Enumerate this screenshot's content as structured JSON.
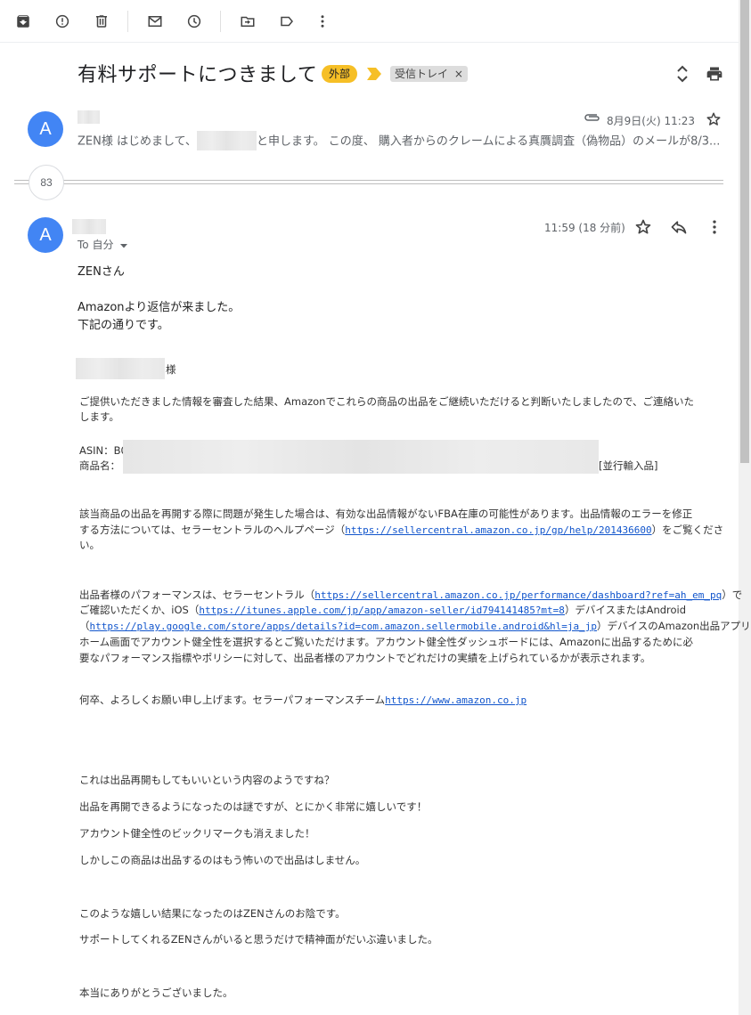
{
  "subject": "有料サポートにつきまして",
  "labels": {
    "external": "外部",
    "inbox": "受信トレイ",
    "inbox_remove": "×"
  },
  "collapsed_count": "83",
  "first_message": {
    "avatar_initial": "A",
    "date": "8月9日(火) 11:23",
    "snippet_a": "ZEN様 はじめまして、",
    "snippet_b": "と申します。 この度、 購入者からのクレームによる真贋調査（偽物品）のメールが8/3..."
  },
  "second_message": {
    "avatar_initial": "A",
    "to_label": "To 自分",
    "time": "11:59 (18 分前)"
  },
  "body": {
    "greeting": "ZENさん",
    "line1": "Amazonより返信が来ました。",
    "line2": "下記の通りです。",
    "sama": "様",
    "q1a": "ご提供いただきました情報を審査した結果、Amazonでこれらの商品の出品をご継続いただけると判断いたしましたので、ご連絡いた",
    "q1b": "します。",
    "asin": "ASIN：B0",
    "product_name": "商品名：",
    "parallel_import": "[並行輸入品]",
    "q2a": "該当商品の出品を再開する際に問題が発生した場合は、有効な出品情報がないFBA在庫の可能性があります。出品情報のエラーを修正",
    "q2b_pre": "する方法については、セラーセントラルのヘルプページ（",
    "q2b_link": "https://sellercentral.amazon.co.jp/gp/help/201436600",
    "q2b_post": "）をご覧くださ",
    "q2c": "い。",
    "q3a_pre": "出品者様のパフォーマンスは、セラーセントラル（",
    "q3a_link": "https://sellercentral.amazon.co.jp/performance/dashboard?ref=ah_em_pq",
    "q3a_post": "）で",
    "q3b_pre": "ご確認いただくか、iOS（",
    "q3b_link": "https://itunes.apple.com/jp/app/amazon-seller/id794141485?mt=8",
    "q3b_post": "）デバイスまたはAndroid",
    "q3c_pre": "（",
    "q3c_link": "https://play.google.com/store/apps/details?id=com.amazon.sellermobile.android&hl=ja_jp",
    "q3c_post": "）デバイスのAmazon出品アプリの",
    "q3d": "ホーム画面でアカウント健全性を選択するとご覧いただけます。アカウント健全性ダッシュボードには、Amazonに出品するために必",
    "q3e": "要なパフォーマンス指標やポリシーに対して、出品者様のアカウントでどれだけの実績を上げられているかが表示されます。",
    "q4_pre": "何卒、よろしくお願い申し上げます。セラーパフォーマンスチーム",
    "q4_link": "https://www.amazon.co.jp",
    "r1": "これは出品再開もしてもいいという内容のようですね？",
    "r2": "出品を再開できるようになったのは謎ですが、とにかく非常に嬉しいです！",
    "r3": "アカウント健全性のビックリマークも消えました！",
    "r4": "しかしこの商品は出品するのはもう怖いので出品はしません。",
    "r5": "このような嬉しい結果になったのはZENさんのお陰です。",
    "r6": "サポートしてくれるZENさんがいると思うだけで精神面がだいぶ違いました。",
    "r7": "本当にありがとうございました。"
  }
}
